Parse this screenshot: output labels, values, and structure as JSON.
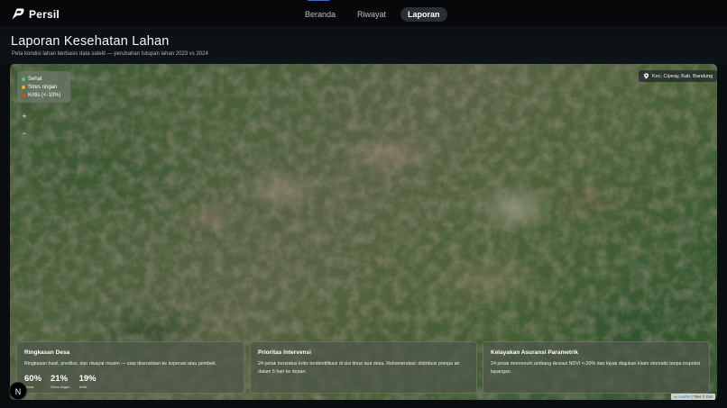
{
  "brand": {
    "name": "Persil"
  },
  "nav": {
    "tabs": [
      {
        "label": "Beranda",
        "active": false
      },
      {
        "label": "Riwayat",
        "active": false
      },
      {
        "label": "Laporan",
        "active": true
      }
    ]
  },
  "header": {
    "title": "Laporan Kesehatan Lahan",
    "subtitle": "Peta kondisi lahan berbasis data satelit — perubahan tutupan lahan 2023 vs 2024"
  },
  "map": {
    "legend": [
      {
        "label": "Sehat",
        "color": "#3fd15a"
      },
      {
        "label": "Stres ringan",
        "color": "#e6b32a"
      },
      {
        "label": "Kritis (<-10%)",
        "color": "#e0452f"
      }
    ],
    "zoom_in": "+",
    "zoom_out": "−",
    "location": "Kec. Cipeay, Kab. Bandung",
    "attribution": {
      "link": "Leaflet",
      "text": "| Tiles © Esri"
    }
  },
  "cards": {
    "summary": {
      "title": "Ringkasan Desa",
      "body": "Ringkasan hasil, prediksi, dan riwayat musim — siap diserahkan ke koperasi atau pembeli.",
      "stats": [
        {
          "value": "60%",
          "label": "Sehat"
        },
        {
          "value": "21%",
          "label": "Stres ringan"
        },
        {
          "value": "19%",
          "label": "Kritis"
        }
      ]
    },
    "priority": {
      "title": "Prioritas Intervensi",
      "body": "24 petak berstatus kritis teridentifikasi di sisi timur laut desa. Rekomendasi: distribusi pompa air dalam 5 hari ke depan."
    },
    "insurance": {
      "title": "Kelayakan Asuransi Parametrik",
      "body": "24 petak memenuhi ambang deviasi NDVI <-20% dan layak diajukan klaim otomatis tanpa inspeksi lapangan."
    }
  },
  "fab": {
    "label": "N"
  }
}
